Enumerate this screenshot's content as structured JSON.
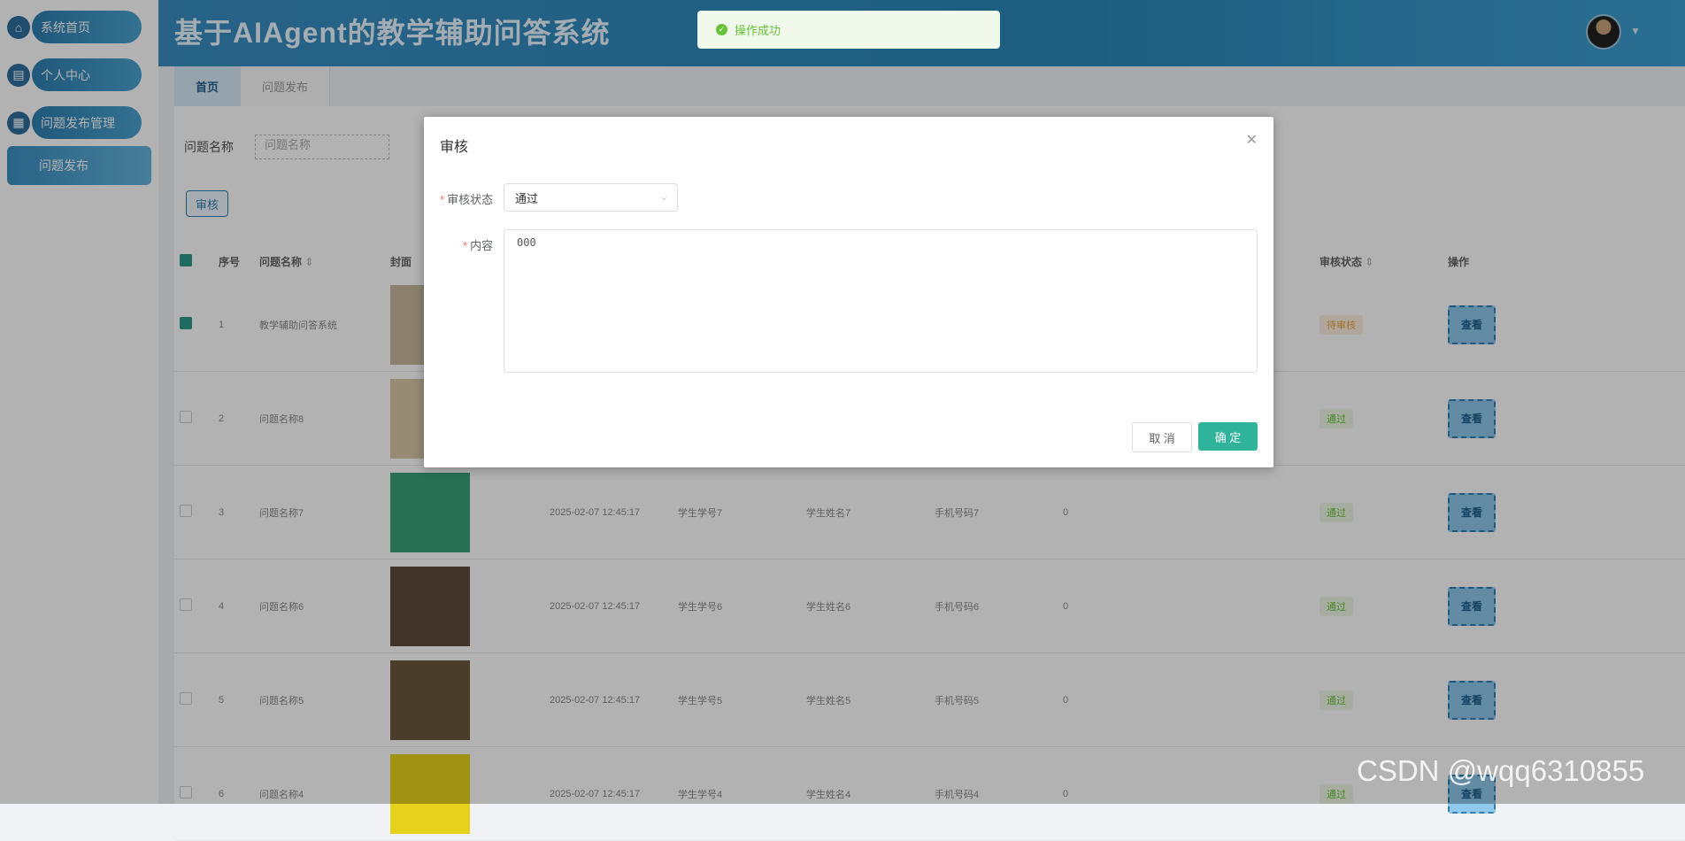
{
  "app": {
    "title": "基于AIAgent的教学辅助问答系统"
  },
  "sidebar": {
    "items": [
      {
        "label": "系统首页",
        "icon": "home-icon"
      },
      {
        "label": "个人中心",
        "icon": "calendar-icon"
      },
      {
        "label": "问题发布管理",
        "icon": "grid-icon"
      }
    ],
    "sub_item": "问题发布"
  },
  "tabs": [
    {
      "label": "首页",
      "active": true
    },
    {
      "label": "问题发布",
      "active": false
    }
  ],
  "search": {
    "label": "问题名称",
    "placeholder": "问题名称"
  },
  "toolbar": {
    "audit_label": "审核"
  },
  "table": {
    "headers": {
      "index": "序号",
      "name": "问题名称",
      "cover": "封面",
      "status": "审核状态",
      "operation": "操作"
    },
    "rows": [
      {
        "checked": true,
        "index": "1",
        "name": "教学辅助问答系统",
        "time": "",
        "student_id": "",
        "student_name": "",
        "phone": "",
        "count": "",
        "status": "待审核",
        "status_type": "pending",
        "cover_color": "#c9b9a0"
      },
      {
        "checked": false,
        "index": "2",
        "name": "问题名称8",
        "time": "",
        "student_id": "",
        "student_name": "",
        "phone": "",
        "count": "",
        "status": "通过",
        "status_type": "pass",
        "cover_color": "#d8c7a8"
      },
      {
        "checked": false,
        "index": "3",
        "name": "问题名称7",
        "time": "2025-02-07 12:45:17",
        "student_id": "学生学号7",
        "student_name": "学生姓名7",
        "phone": "手机号码7",
        "count": "0",
        "status": "通过",
        "status_type": "pass",
        "cover_color": "#3aa07c"
      },
      {
        "checked": false,
        "index": "4",
        "name": "问题名称6",
        "time": "2025-02-07 12:45:17",
        "student_id": "学生学号6",
        "student_name": "学生姓名6",
        "phone": "手机号码6",
        "count": "0",
        "status": "通过",
        "status_type": "pass",
        "cover_color": "#5c4a3b"
      },
      {
        "checked": false,
        "index": "5",
        "name": "问题名称5",
        "time": "2025-02-07 12:45:17",
        "student_id": "学生学号5",
        "student_name": "学生姓名5",
        "phone": "手机号码5",
        "count": "0",
        "status": "通过",
        "status_type": "pass",
        "cover_color": "#6b5a3e"
      },
      {
        "checked": false,
        "index": "6",
        "name": "问题名称4",
        "time": "2025-02-07 12:45:17",
        "student_id": "学生学号4",
        "student_name": "学生姓名4",
        "phone": "手机号码4",
        "count": "0",
        "status": "通过",
        "status_type": "pass",
        "cover_color": "#e6d21c"
      }
    ],
    "view_label": "查看"
  },
  "toast": {
    "message": "操作成功"
  },
  "dialog": {
    "title": "审核",
    "status_label": "审核状态",
    "status_value": "通过",
    "content_label": "内容",
    "content_value": "000",
    "cancel_label": "取 消",
    "confirm_label": "确 定"
  },
  "watermark": "CSDN @wqq6310855",
  "colors": {
    "accent": "#2f7fb0",
    "confirm": "#2fb39a",
    "success": "#67c23a",
    "pending": "#e6a23c"
  }
}
